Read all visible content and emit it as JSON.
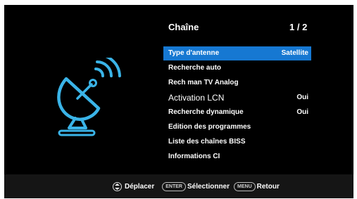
{
  "header": {
    "title": "Chaîne",
    "page": "1 / 2"
  },
  "menu": [
    {
      "label": "Type d'antenne",
      "value": "Satellite",
      "selected": true
    },
    {
      "label": "Recherche auto",
      "value": ""
    },
    {
      "label": "Rech man TV Analog",
      "value": ""
    },
    {
      "label": "Activation LCN",
      "value": "Oui"
    },
    {
      "label": "Recherche dynamique",
      "value": "Oui"
    },
    {
      "label": "Edition des programmes",
      "value": ""
    },
    {
      "label": "Liste des chaînes BISS",
      "value": ""
    },
    {
      "label": "Informations CI",
      "value": ""
    }
  ],
  "footer": {
    "move_label": "Déplacer",
    "enter_key": "ENTER",
    "select_label": "Sélectionner",
    "menu_key": "MENU",
    "back_label": "Retour"
  },
  "icons": {
    "satellite": "satellite-dish-icon",
    "nav": "navigation-arrows-icon"
  },
  "colors": {
    "background": "#000000",
    "highlight": "#1678d2",
    "footer": "#151515",
    "accent": "#3ab4e8"
  }
}
